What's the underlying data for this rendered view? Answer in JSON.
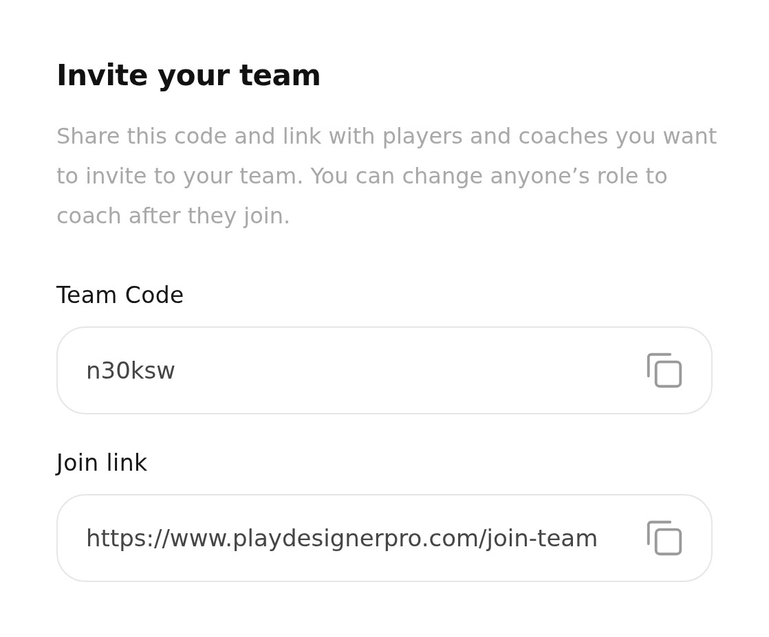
{
  "title": "Invite your team",
  "description": "Share this code and link with players and coaches you want to invite to your team. You can change anyone’s role to coach after they join.",
  "fields": [
    {
      "label": "Team Code",
      "value": "n30ksw"
    },
    {
      "label": "Join link",
      "value": "https://www.playdesignerpro.com/join-team"
    }
  ]
}
